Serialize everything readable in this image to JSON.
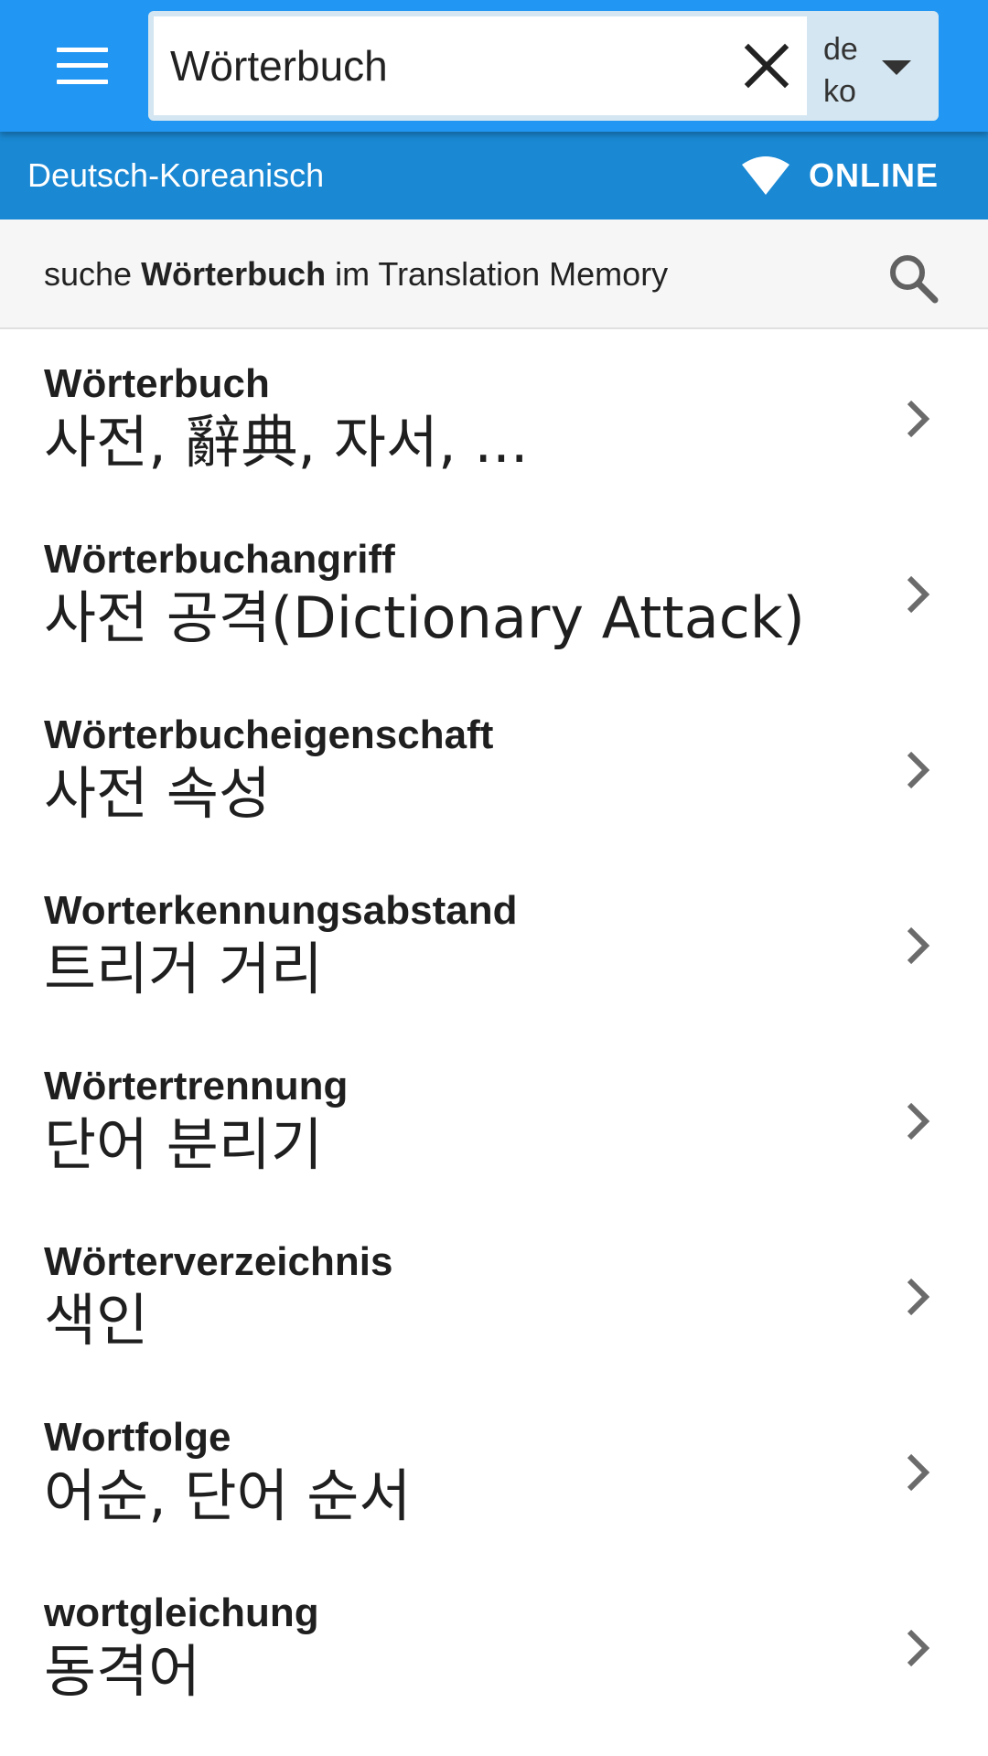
{
  "search": {
    "query": "Wörterbuch",
    "clear_icon": "close-icon",
    "lang_from": "de",
    "lang_to": "ko"
  },
  "subbar": {
    "dictionary_name": "Deutsch-Koreanisch",
    "status": "ONLINE",
    "status_icon": "wifi-icon"
  },
  "tm_search": {
    "prefix": "suche ",
    "term": "Wörterbuch",
    "suffix": " im Translation Memory"
  },
  "results": [
    {
      "term": "Wörterbuch",
      "translation": "사전, 辭典, 자서, ..."
    },
    {
      "term": "Wörterbuchangriff",
      "translation": "사전 공격(Dictionary Attack)"
    },
    {
      "term": "Wörterbucheigenschaft",
      "translation": "사전 속성"
    },
    {
      "term": "Worterkennungsabstand",
      "translation": "트리거 거리"
    },
    {
      "term": "Wörtertrennung",
      "translation": "단어 분리기"
    },
    {
      "term": "Wörterverzeichnis",
      "translation": "색인"
    },
    {
      "term": "Wortfolge",
      "translation": "어순, 단어 순서"
    },
    {
      "term": "wortgleichung",
      "translation": "동격어"
    }
  ],
  "colors": {
    "appbar": "#2196f3",
    "subbar": "#1a88d3",
    "lang_switch_bg": "#d4e6f1"
  }
}
